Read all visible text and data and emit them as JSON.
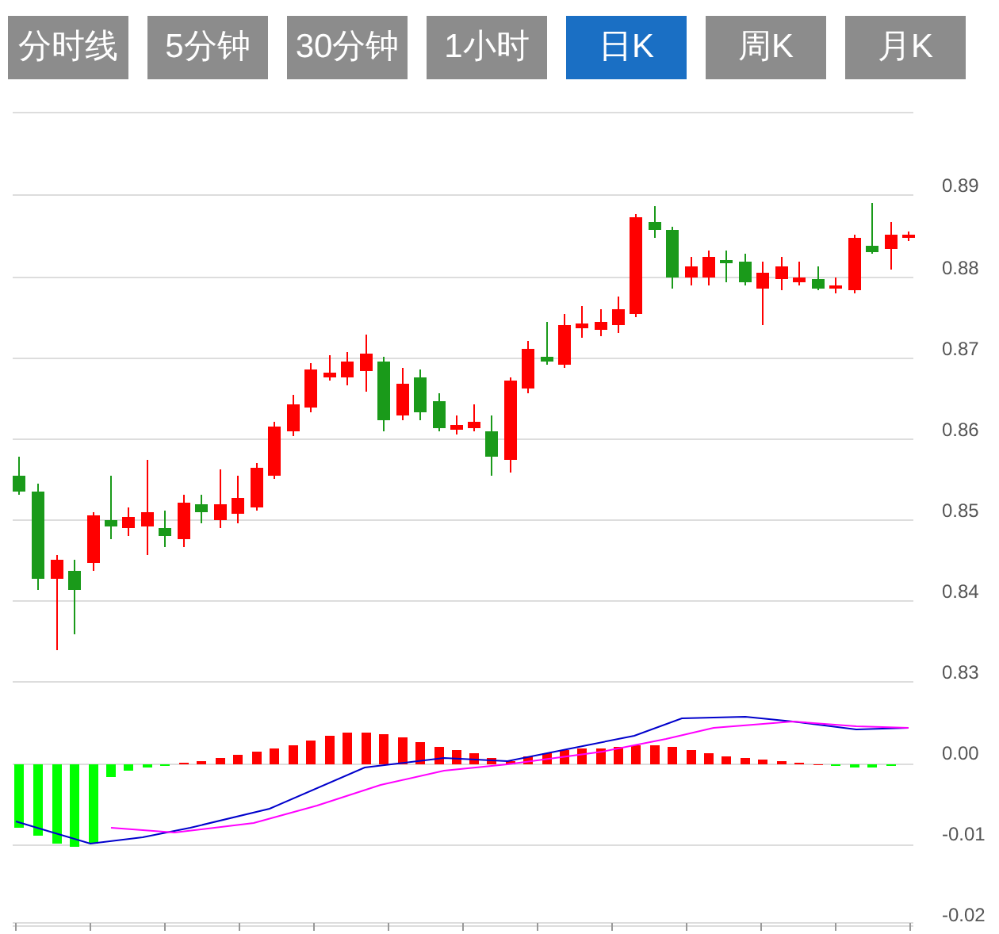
{
  "tabs": [
    {
      "label": "分时线",
      "selected": false
    },
    {
      "label": "5分钟",
      "selected": false
    },
    {
      "label": "30分钟",
      "selected": false
    },
    {
      "label": "1小时",
      "selected": false
    },
    {
      "label": "日K",
      "selected": true
    },
    {
      "label": "周K",
      "selected": false
    },
    {
      "label": "月K",
      "selected": false
    }
  ],
  "price_axis": {
    "ticks": [
      "0.89",
      "0.88",
      "0.87",
      "0.86",
      "0.85",
      "0.84",
      "0.83"
    ]
  },
  "macd_axis": {
    "ticks": [
      "0.00",
      "-0.01",
      "-0.02"
    ]
  }
}
